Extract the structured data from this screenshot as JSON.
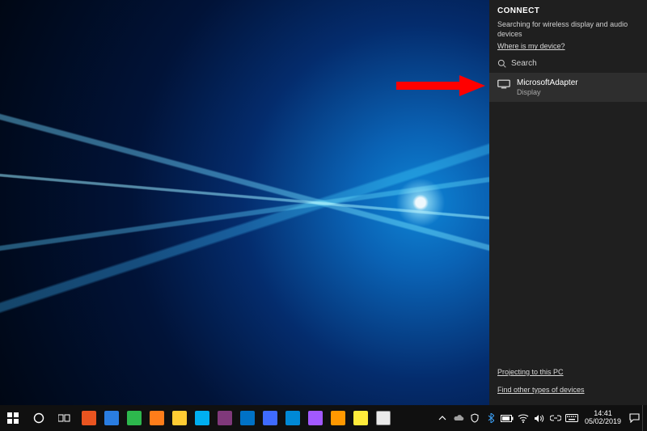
{
  "connect": {
    "title": "CONNECT",
    "searching_text": "Searching for wireless display and audio devices",
    "where_is_device_link": "Where is my device?",
    "search_placeholder": "Search",
    "device": {
      "name": "MicrosoftAdapter",
      "type": "Display"
    },
    "projecting_link": "Projecting to this PC",
    "other_devices_link": "Find other types of devices"
  },
  "taskbar": {
    "clock": {
      "time": "14:41",
      "date": "05/02/2019"
    },
    "tray_icons": [
      "chevron-up-icon",
      "onedrive-icon",
      "security-icon",
      "bluetooth-icon",
      "battery-icon",
      "wifi-icon",
      "volume-icon",
      "link-icon",
      "keyboard-icon"
    ],
    "pinned": [
      {
        "id": "start",
        "color": "#ffffff"
      },
      {
        "id": "cortana",
        "color": "#ffffff"
      },
      {
        "id": "task-view",
        "color": "#ffffff"
      },
      {
        "id": "ubuntu",
        "color": "#e95420"
      },
      {
        "id": "edge",
        "color": "#2a7de1"
      },
      {
        "id": "chrome",
        "color": "#2db84d"
      },
      {
        "id": "firefox",
        "color": "#ff7d1a"
      },
      {
        "id": "explorer",
        "color": "#ffcc33"
      },
      {
        "id": "skype",
        "color": "#00aff0"
      },
      {
        "id": "onenote",
        "color": "#80397b"
      },
      {
        "id": "outlook",
        "color": "#0072c6"
      },
      {
        "id": "todo",
        "color": "#3f6bff"
      },
      {
        "id": "azure",
        "color": "#0089d6"
      },
      {
        "id": "figma",
        "color": "#a259ff"
      },
      {
        "id": "sublime",
        "color": "#ff9800"
      },
      {
        "id": "notepad",
        "color": "#ffeb3b"
      },
      {
        "id": "basecamp",
        "color": "#ffffff"
      }
    ]
  },
  "colors": {
    "arrow": "#ff0000"
  }
}
